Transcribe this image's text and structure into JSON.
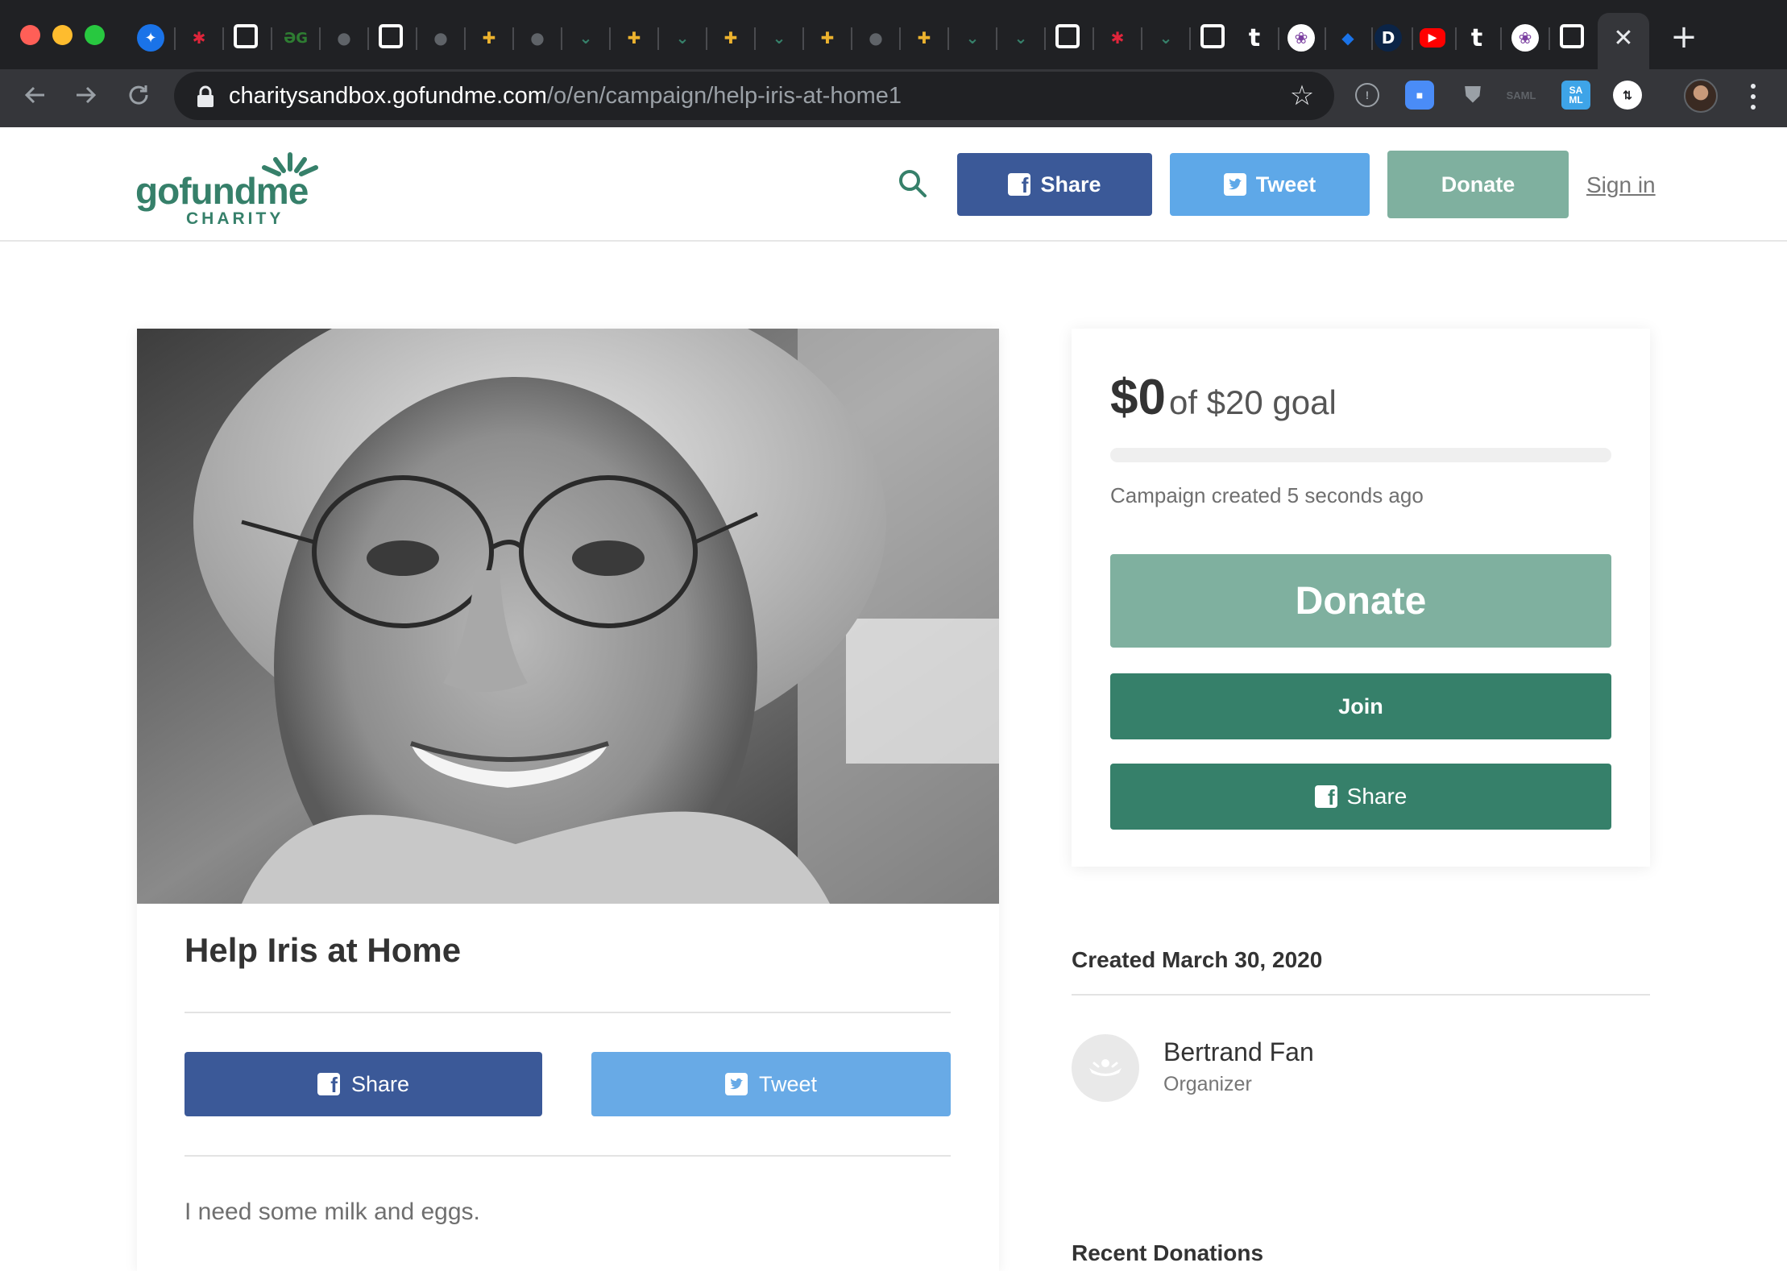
{
  "browser": {
    "url_host": "charitysandbox.gofundme.com",
    "url_path": "/o/en/campaign/help-iris-at-home1",
    "active_tab_close": "✕",
    "new_tab": "+",
    "extension_labels": [
      "SA ML"
    ]
  },
  "header": {
    "logo_word": "gofundme",
    "logo_sub": "CHARITY",
    "share_label": "Share",
    "tweet_label": "Tweet",
    "donate_label": "Donate",
    "signin_label": "Sign in"
  },
  "campaign": {
    "title": "Help Iris at Home",
    "share_label": "Share",
    "tweet_label": "Tweet",
    "story": "I need some milk and eggs."
  },
  "sidebar": {
    "raised": "$0",
    "goal_text": "of $20 goal",
    "progress_percent": 0,
    "created_ago": "Campaign created 5 seconds ago",
    "donate_label": "Donate",
    "join_label": "Join",
    "share_label": "Share",
    "created_date": "Created March 30, 2020",
    "organizer_name": "Bertrand Fan",
    "organizer_role": "Organizer",
    "recent_heading": "Recent Donations"
  },
  "colors": {
    "brand_green": "#36806a",
    "donate_green_disabled": "#7fb09f",
    "facebook_blue": "#3b5998",
    "twitter_blue": "#5ea8e8"
  }
}
